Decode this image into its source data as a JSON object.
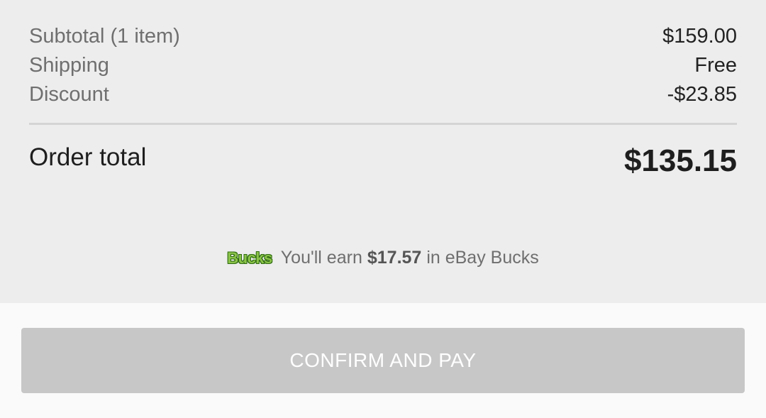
{
  "summary": {
    "subtotal_label": "Subtotal (1 item)",
    "subtotal_value": "$159.00",
    "shipping_label": "Shipping",
    "shipping_value": "Free",
    "discount_label": "Discount",
    "discount_value": "-$23.85",
    "total_label": "Order total",
    "total_value": "$135.15"
  },
  "bucks": {
    "logo_text": "Bucks",
    "prefix": "You'll earn",
    "amount": "$17.57",
    "suffix": "in eBay Bucks"
  },
  "footer": {
    "confirm_label": "CONFIRM AND PAY",
    "confirm_enabled": false
  },
  "colors": {
    "background": "#ededed",
    "footer_background": "#fafafa",
    "button_disabled": "#c7c7c7",
    "bucks_green": "#8bc34a"
  }
}
